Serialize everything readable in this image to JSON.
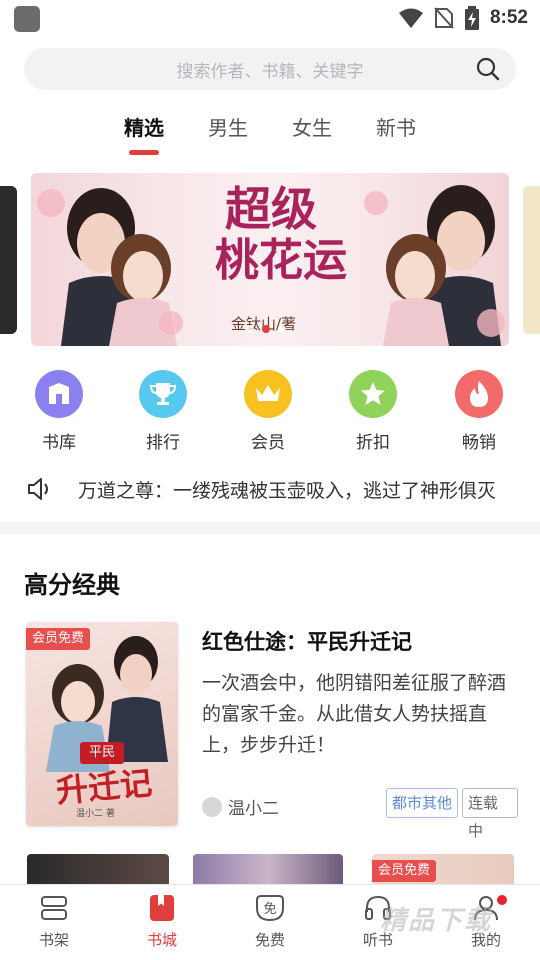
{
  "status_bar": {
    "time": "8:52"
  },
  "search": {
    "placeholder": "搜索作者、书籍、关键字"
  },
  "tabs": [
    {
      "label": "精选",
      "active": true
    },
    {
      "label": "男生",
      "active": false
    },
    {
      "label": "女生",
      "active": false
    },
    {
      "label": "新书",
      "active": false
    }
  ],
  "banner": {
    "title_line1": "超级",
    "title_line2": "桃花运",
    "author": "金钛山/著",
    "page_count": 3,
    "active_page": 2
  },
  "quick_entries": [
    {
      "label": "书库",
      "icon": "library-icon",
      "color": "#8b80f0"
    },
    {
      "label": "排行",
      "icon": "trophy-icon",
      "color": "#57c8ef"
    },
    {
      "label": "会员",
      "icon": "crown-icon",
      "color": "#f7c21f"
    },
    {
      "label": "折扣",
      "icon": "star-icon",
      "color": "#8fd35a"
    },
    {
      "label": "畅销",
      "icon": "flame-icon",
      "color": "#f26a6a"
    }
  ],
  "notice": {
    "text": "万道之尊：一缕残魂被玉壶吸入，逃过了神形俱灭",
    "icon": "speaker-icon"
  },
  "section": {
    "title": "高分经典"
  },
  "featured_book": {
    "badge": "会员免费",
    "cover_title": "升迁记",
    "cover_subtitle": "平民",
    "cover_author": "温小二 著",
    "title": "红色仕途：平民升迁记",
    "description": "一次酒会中，他阴错阳差征服了醉酒的富家千金。从此借女人势扶摇直上，步步升迁！",
    "author": "温小二",
    "tags": [
      "都市其他",
      "连载中"
    ]
  },
  "more_books": [
    {
      "badge": ""
    },
    {
      "badge": ""
    },
    {
      "badge": "会员免费"
    }
  ],
  "bottom_nav": [
    {
      "label": "书架",
      "icon": "bookshelf-icon",
      "active": false
    },
    {
      "label": "书城",
      "icon": "bookstore-icon",
      "active": true
    },
    {
      "label": "免费",
      "icon": "free-icon",
      "active": false
    },
    {
      "label": "听书",
      "icon": "headphones-icon",
      "active": false
    },
    {
      "label": "我的",
      "icon": "profile-icon",
      "active": false,
      "has_dot": true
    }
  ],
  "watermark": "精品下载",
  "colors": {
    "accent": "#e23d3d",
    "tag_blue": "#5b8ad6"
  }
}
